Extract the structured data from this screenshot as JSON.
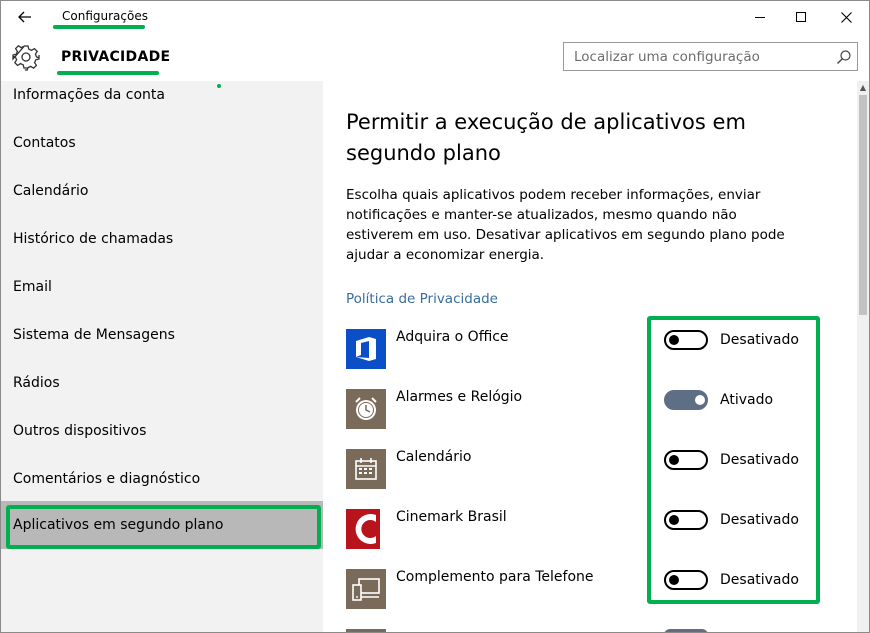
{
  "window": {
    "title": "Configurações"
  },
  "header": {
    "section_title": "PRIVACIDADE",
    "search_placeholder": "Localizar uma configuração"
  },
  "sidebar": {
    "items": [
      {
        "label": "Informações da conta"
      },
      {
        "label": "Contatos"
      },
      {
        "label": "Calendário"
      },
      {
        "label": "Histórico de chamadas"
      },
      {
        "label": "Email"
      },
      {
        "label": "Sistema de Mensagens"
      },
      {
        "label": "Rádios"
      },
      {
        "label": "Outros dispositivos"
      },
      {
        "label": "Comentários e diagnóstico"
      },
      {
        "label": "Aplicativos em segundo plano",
        "selected": true
      }
    ]
  },
  "main": {
    "title": "Permitir a execução de aplicativos em segundo plano",
    "description": "Escolha quais aplicativos podem receber informações, enviar notificações e manter-se atualizados, mesmo quando não estiverem em uso. Desativar aplicativos em segundo plano pode ajudar a economizar energia.",
    "privacy_link": "Política de Privacidade",
    "apps": [
      {
        "name": "Adquira o Office",
        "state": "Desativado",
        "on": false,
        "icon": "office-icon",
        "color": "#0a4fc7"
      },
      {
        "name": "Alarmes e Relógio",
        "state": "Ativado",
        "on": true,
        "icon": "alarm-clock-icon",
        "color": "#7a6a5a"
      },
      {
        "name": "Calendário",
        "state": "Desativado",
        "on": false,
        "icon": "calendar-icon",
        "color": "#7a6a5a"
      },
      {
        "name": "Cinemark Brasil",
        "state": "Desativado",
        "on": false,
        "icon": "cinemark-icon",
        "color": "#b8141c"
      },
      {
        "name": "Complemento para Telefone",
        "state": "Desativado",
        "on": false,
        "icon": "phone-companion-icon",
        "color": "#7a6a5a"
      }
    ]
  },
  "colors": {
    "accent": "#5e6e84",
    "highlight": "#00b050",
    "link": "#3a6d9e"
  }
}
